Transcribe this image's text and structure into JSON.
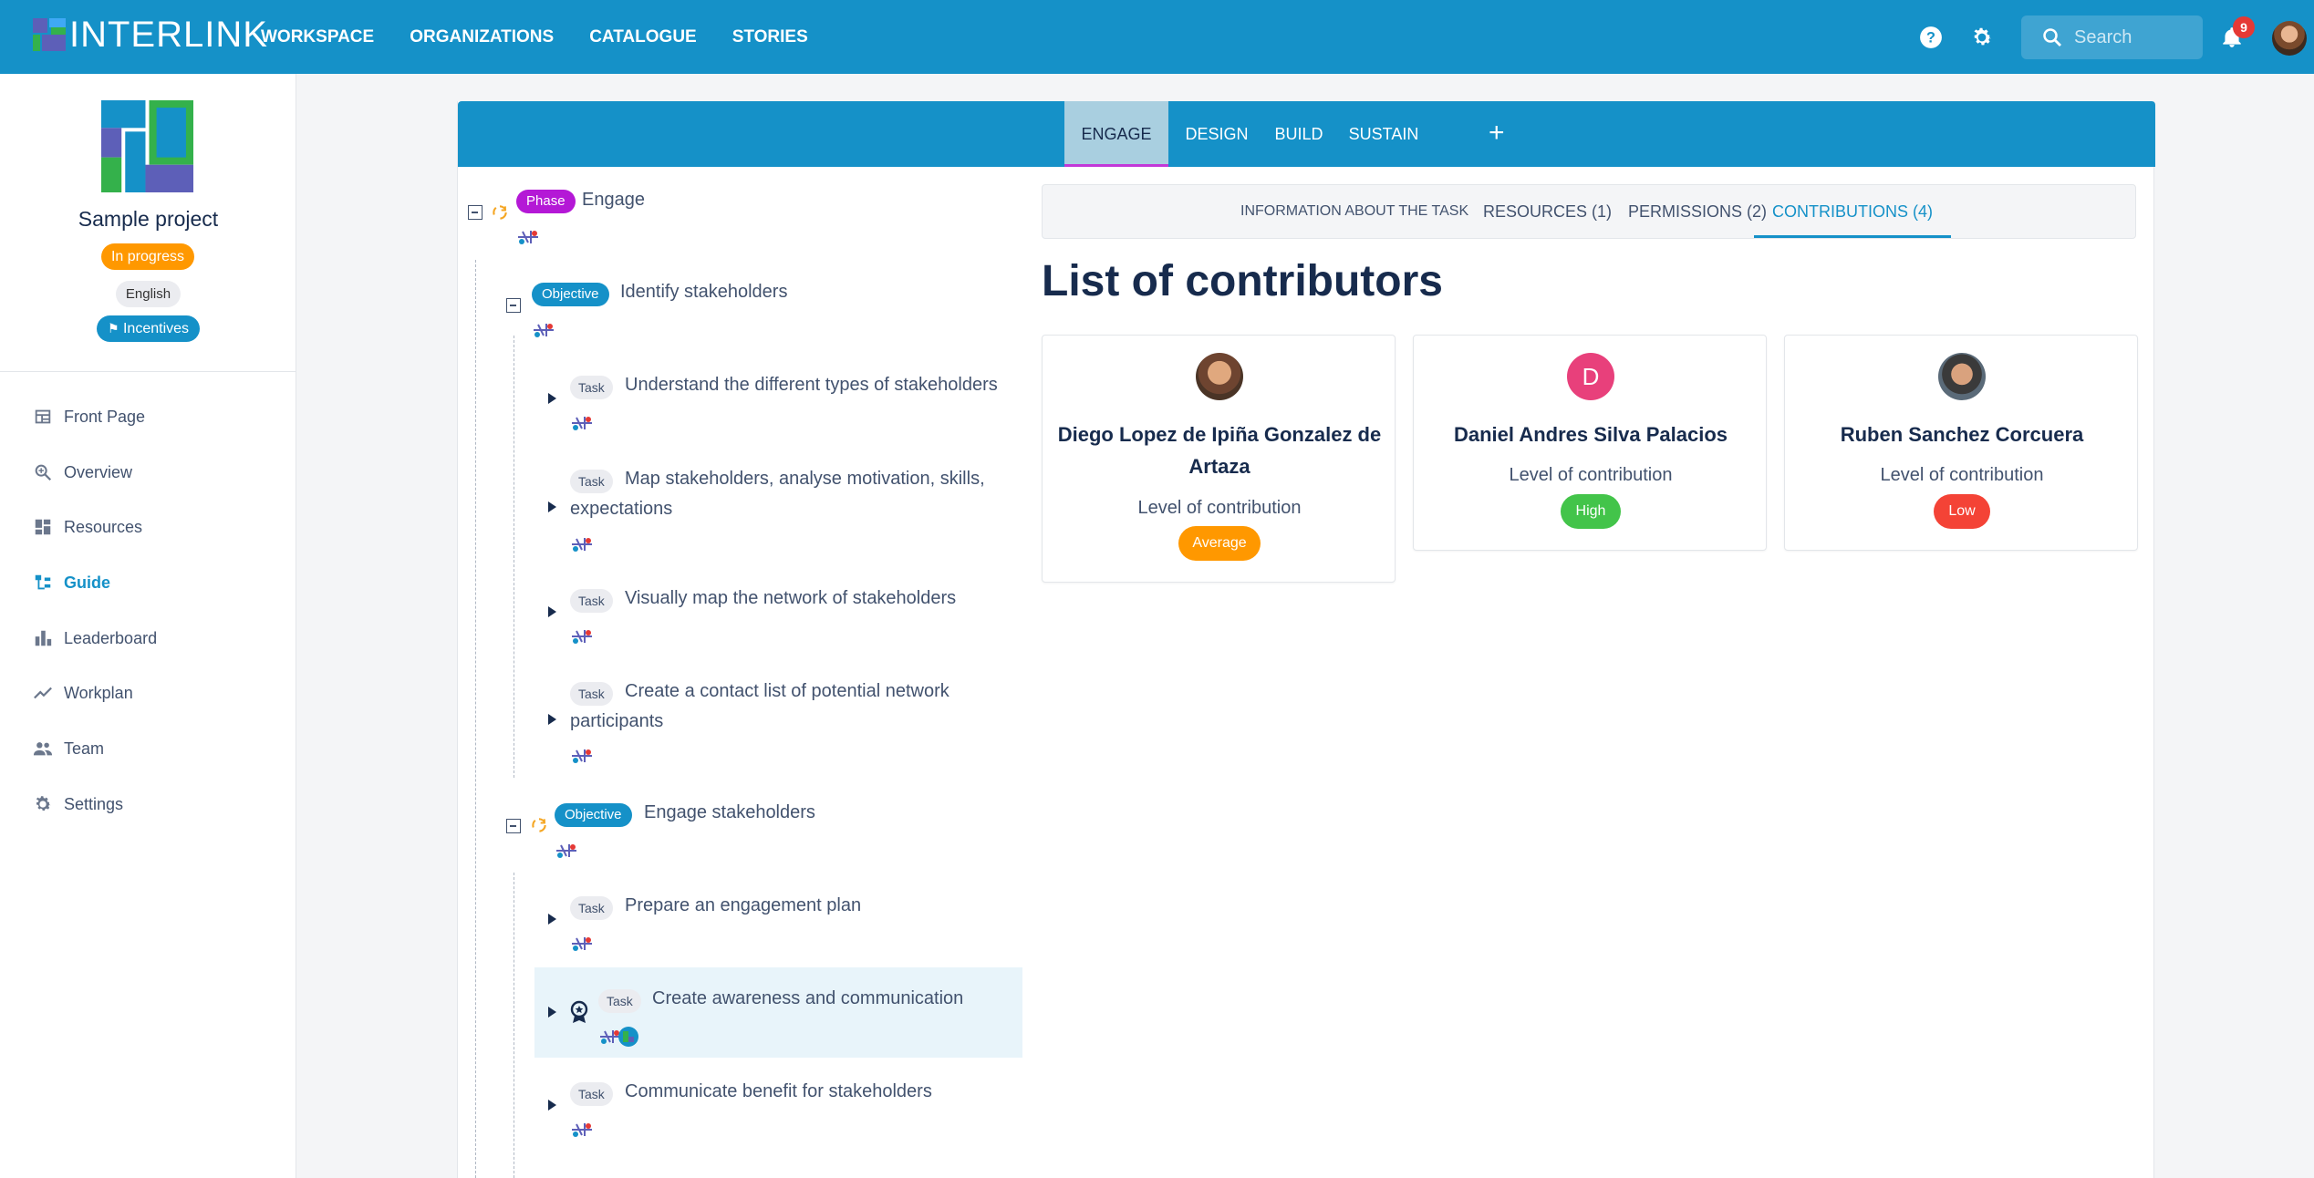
{
  "app": {
    "brand": "INTERLINK",
    "nav": [
      "WORKSPACE",
      "ORGANIZATIONS",
      "CATALOGUE",
      "STORIES"
    ],
    "search_placeholder": "Search",
    "notification_count": "9"
  },
  "sidebar": {
    "project_title": "Sample project",
    "status": "In progress",
    "language": "English",
    "incentives": "Incentives",
    "items": [
      {
        "label": "Front Page",
        "icon": "front-page-icon"
      },
      {
        "label": "Overview",
        "icon": "overview-icon"
      },
      {
        "label": "Resources",
        "icon": "resources-icon"
      },
      {
        "label": "Guide",
        "icon": "guide-icon",
        "active": true
      },
      {
        "label": "Leaderboard",
        "icon": "leaderboard-icon"
      },
      {
        "label": "Workplan",
        "icon": "workplan-icon"
      },
      {
        "label": "Team",
        "icon": "team-icon"
      },
      {
        "label": "Settings",
        "icon": "gear-icon"
      }
    ]
  },
  "phases": {
    "tabs": [
      "ENGAGE",
      "DESIGN",
      "BUILD",
      "SUSTAIN"
    ],
    "active": "ENGAGE",
    "add": "+"
  },
  "tree": {
    "phase": {
      "chip": "Phase",
      "label": "Engage"
    },
    "objectives": [
      {
        "chip": "Objective",
        "label": "Identify stakeholders",
        "tasks": [
          {
            "chip": "Task",
            "label": "Understand the different types of stakeholders"
          },
          {
            "chip": "Task",
            "label": "Map stakeholders, analyse motivation, skills, expectations"
          },
          {
            "chip": "Task",
            "label": "Visually map the network of stakeholders"
          },
          {
            "chip": "Task",
            "label": "Create a contact list of potential network participants"
          }
        ]
      },
      {
        "chip": "Objective",
        "label": "Engage stakeholders",
        "tasks": [
          {
            "chip": "Task",
            "label": "Prepare an engagement plan"
          },
          {
            "chip": "Task",
            "label": "Create awareness and communication"
          },
          {
            "chip": "Task",
            "label": "Communicate benefit for stakeholders"
          }
        ]
      }
    ]
  },
  "task_tabs": {
    "items": [
      "INFORMATION ABOUT THE TASK",
      "RESOURCES (1)",
      "PERMISSIONS (2)",
      "CONTRIBUTIONS (4)"
    ],
    "active": "CONTRIBUTIONS (4)"
  },
  "contributors": {
    "title": "List of contributors",
    "level_label": "Level of contribution",
    "cards": [
      {
        "name": "Diego Lopez de Ipiña Gonzalez de Artaza",
        "level": "Average",
        "color": "#ff9800"
      },
      {
        "name": "Daniel Andres Silva Palacios",
        "level": "High",
        "color": "#43c44a",
        "initial": "D",
        "avatar_color": "#e8407b"
      },
      {
        "name": "Ruben Sanchez Corcuera",
        "level": "Low",
        "color": "#f44336"
      }
    ]
  },
  "colors": {
    "primary": "#1591c8",
    "phase": "#b418d6",
    "in_progress": "#ff9800"
  }
}
